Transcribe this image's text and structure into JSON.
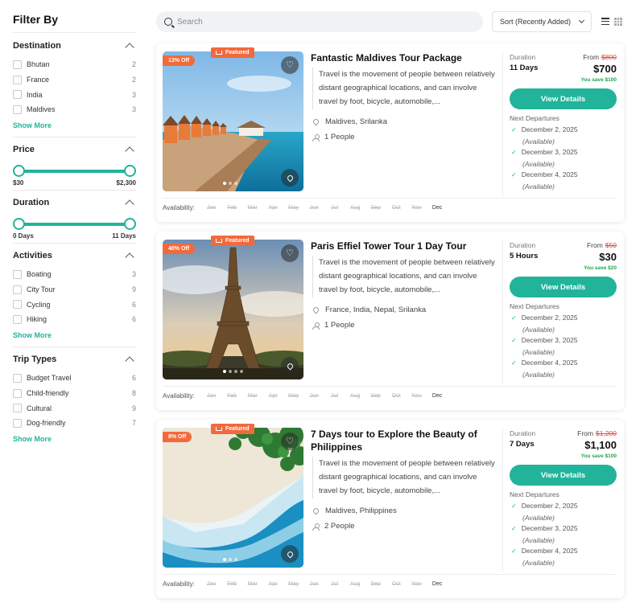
{
  "sidebar": {
    "title": "Filter By",
    "destination": {
      "title": "Destination",
      "items": [
        {
          "label": "Bhutan",
          "count": "2"
        },
        {
          "label": "France",
          "count": "2"
        },
        {
          "label": "India",
          "count": "3"
        },
        {
          "label": "Maldives",
          "count": "3"
        }
      ],
      "show_more": "Show More"
    },
    "price": {
      "title": "Price",
      "min": "$30",
      "max": "$2,300",
      "range": [
        0,
        1
      ]
    },
    "duration": {
      "title": "Duration",
      "min": "0 Days",
      "max": "11 Days",
      "range": [
        0,
        1
      ]
    },
    "activities": {
      "title": "Activities",
      "items": [
        {
          "label": "Boating",
          "count": "3"
        },
        {
          "label": "City Tour",
          "count": "9"
        },
        {
          "label": "Cycling",
          "count": "6"
        },
        {
          "label": "Hiking",
          "count": "6"
        }
      ],
      "show_more": "Show More"
    },
    "trip_types": {
      "title": "Trip Types",
      "items": [
        {
          "label": "Budget Travel",
          "count": "6"
        },
        {
          "label": "Child-friendly",
          "count": "8"
        },
        {
          "label": "Cultural",
          "count": "9"
        },
        {
          "label": "Dog-friendly",
          "count": "7"
        }
      ],
      "show_more": "Show More"
    }
  },
  "toolbar": {
    "search_placeholder": "Search",
    "sort_label": "Sort (Recently Added)",
    "list_view_icon": "list-icon",
    "grid_view_icon": "grid-icon"
  },
  "availability_label": "Availability:",
  "months": [
    "Jan",
    "Feb",
    "Mar",
    "Apr",
    "May",
    "Jun",
    "Jul",
    "Aug",
    "Sep",
    "Oct",
    "Nov",
    "Dec"
  ],
  "colors": {
    "accent": "#22b39b",
    "badge": "#f26a3c",
    "old_price": "#e2483d",
    "save": "#1fa34a"
  },
  "tours": [
    {
      "discount": "13% Off",
      "featured": "Featured",
      "title": "Fantastic Maldives Tour Package",
      "description": "Travel is the movement of people between relatively distant geographical locations, and can involve travel by foot, bicycle, automobile,...",
      "location": "Maldives, Srilanka",
      "people": "1 People",
      "duration_label": "Duration",
      "duration": "11 Days",
      "from_label": "From",
      "old_price": "$800",
      "price": "$700",
      "save": "You save $100",
      "button": "View Details",
      "next_label": "Next Departures",
      "departures": [
        "December 2, 2025",
        "December 3, 2025",
        "December 4, 2025"
      ],
      "available_text": "(Available)",
      "available_months": [
        11
      ],
      "image": "maldives",
      "slides": 3,
      "active_slide": 0
    },
    {
      "discount": "40% Off",
      "featured": "Featured",
      "title": "Paris Effiel Tower Tour 1 Day Tour",
      "description": "Travel is the movement of people between relatively distant geographical locations, and can involve travel by foot, bicycle, automobile,...",
      "location": "France, India, Nepal, Srilanka",
      "people": "1 People",
      "duration_label": "Duration",
      "duration": "5 Hours",
      "from_label": "From",
      "old_price": "$50",
      "price": "$30",
      "save": "You save $20",
      "button": "View Details",
      "next_label": "Next Departures",
      "departures": [
        "December 2, 2025",
        "December 3, 2025",
        "December 4, 2025"
      ],
      "available_text": "(Available)",
      "available_months": [
        11
      ],
      "image": "paris",
      "slides": 4,
      "active_slide": 0
    },
    {
      "discount": "8% Off",
      "featured": "Featured",
      "title": "7 Days tour to Explore the Beauty of Philippines",
      "description": "Travel is the movement of people between relatively distant geographical locations, and can involve travel by foot, bicycle, automobile,...",
      "location": "Maldives, Philippines",
      "people": "2 People",
      "duration_label": "Duration",
      "duration": "7 Days",
      "from_label": "From",
      "old_price": "$1,200",
      "price": "$1,100",
      "save": "You save $100",
      "button": "View Details",
      "next_label": "Next Departures",
      "departures": [
        "December 2, 2025",
        "December 3, 2025",
        "December 4, 2025"
      ],
      "available_text": "(Available)",
      "available_months": [
        11
      ],
      "image": "beach",
      "slides": 3,
      "active_slide": 0
    }
  ]
}
